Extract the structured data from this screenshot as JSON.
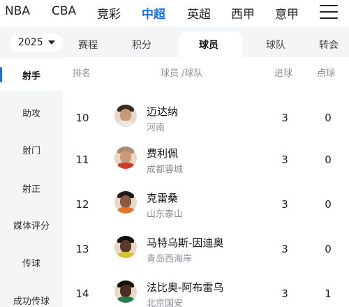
{
  "top_nav": {
    "leagues": [
      "NBA",
      "CBA",
      "竞彩",
      "中超",
      "英超",
      "西甲",
      "意甲"
    ],
    "active": "中超",
    "menu_icon": "hamburger-menu-icon"
  },
  "sub_nav": {
    "season": "2025",
    "tabs": [
      "赛程",
      "积分",
      "球员",
      "球队",
      "转会"
    ],
    "active": "球员"
  },
  "sidebar": {
    "items": [
      "射手",
      "助攻",
      "射门",
      "射正",
      "媒体评分",
      "传球",
      "成功传球"
    ],
    "active": "射手"
  },
  "table": {
    "headers": {
      "rank": "排名",
      "player_team": "球员 /球队",
      "goals": "进球",
      "penalties": "点球"
    },
    "rows": [
      {
        "rank": "10",
        "name": "迈达纳",
        "team": "河南",
        "goals": "3",
        "penalties": "0"
      },
      {
        "rank": "11",
        "name": "费利佩",
        "team": "成都蓉城",
        "goals": "3",
        "penalties": "0"
      },
      {
        "rank": "12",
        "name": "克雷桑",
        "team": "山东泰山",
        "goals": "3",
        "penalties": "0"
      },
      {
        "rank": "13",
        "name": "马特乌斯-因迪奥",
        "team": "青岛西海岸",
        "goals": "3",
        "penalties": "0"
      },
      {
        "rank": "14",
        "name": "法比奥-阿布雷乌",
        "team": "北京国安",
        "goals": "3",
        "penalties": "1"
      }
    ]
  },
  "colors": {
    "accent": "#1e6fe8",
    "sidebar_bg": "#f4f5f7",
    "muted_text": "#8a8f99"
  }
}
